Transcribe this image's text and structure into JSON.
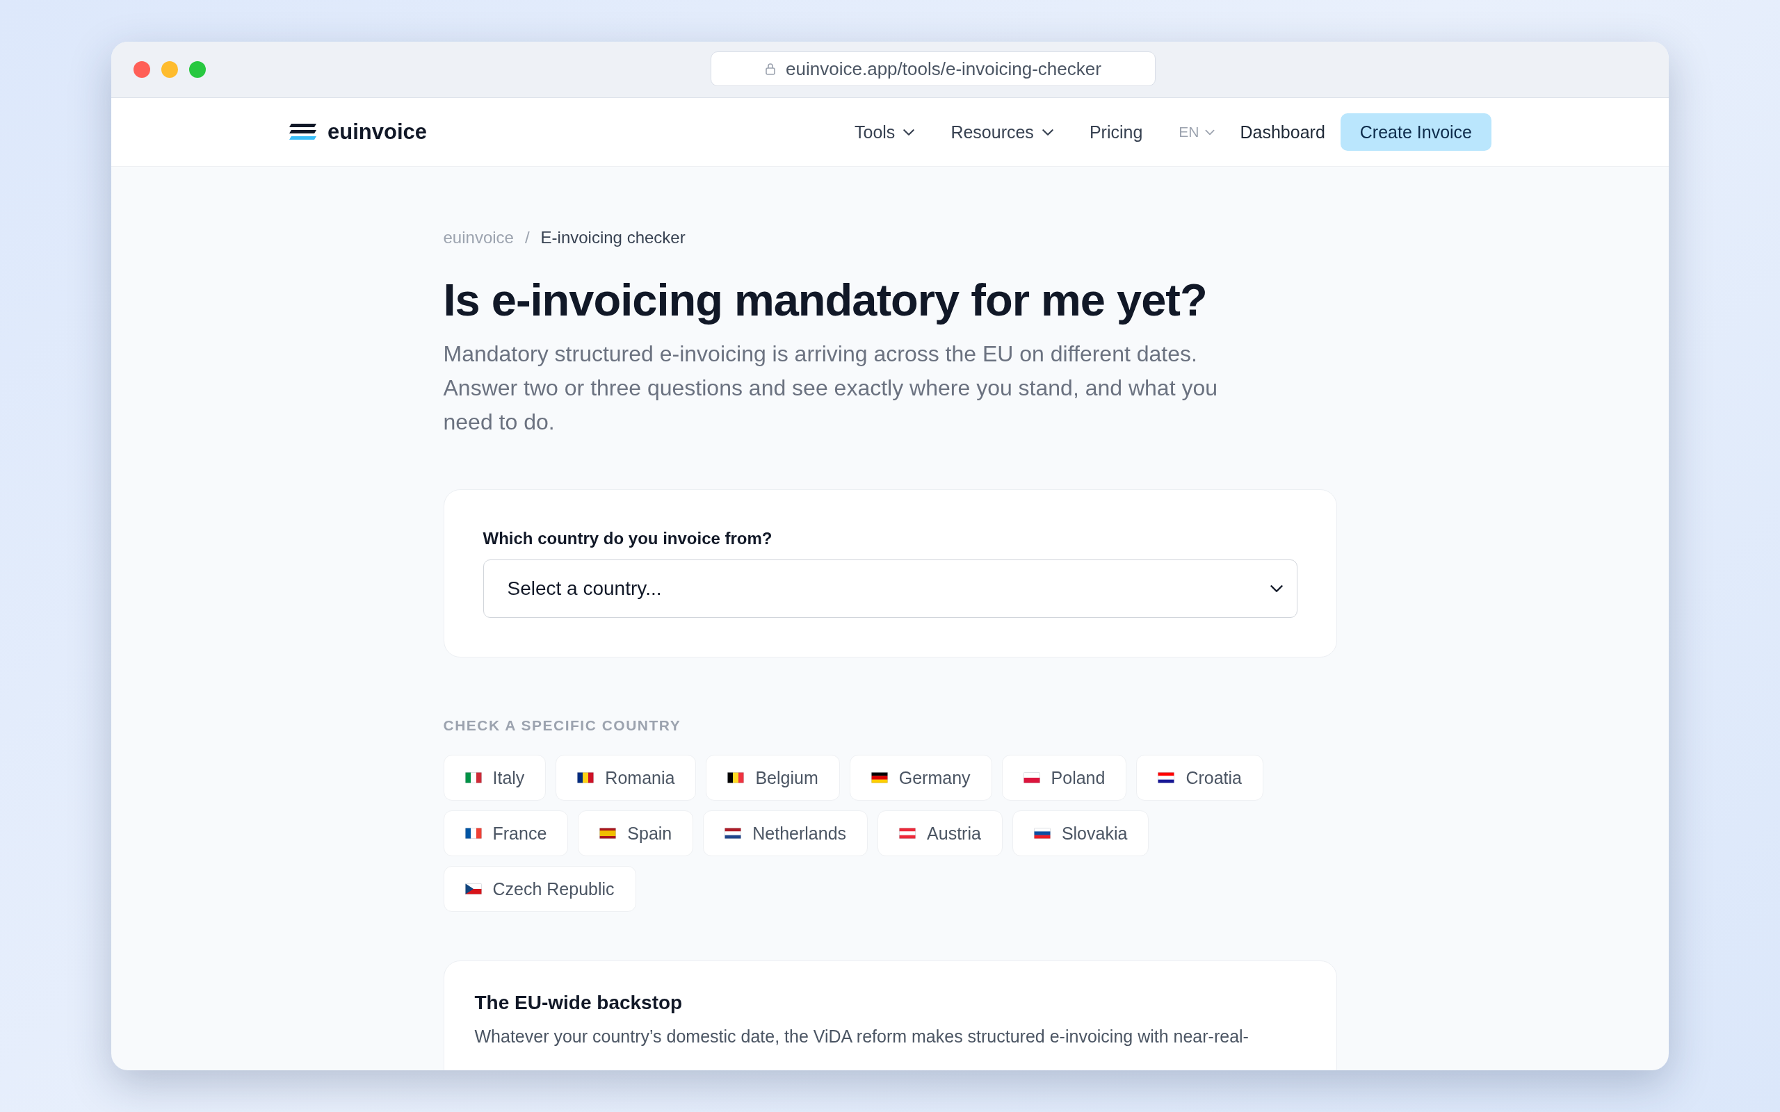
{
  "browser": {
    "url": "euinvoice.app/tools/e-invoicing-checker"
  },
  "nav": {
    "brand": "euinvoice",
    "items": [
      {
        "label": "Tools",
        "dropdown": true
      },
      {
        "label": "Resources",
        "dropdown": true
      },
      {
        "label": "Pricing",
        "dropdown": false
      }
    ],
    "language": "EN",
    "dashboard": "Dashboard",
    "cta": "Create Invoice"
  },
  "breadcrumb": {
    "items": [
      "euinvoice",
      "E-invoicing checker"
    ],
    "separator": "/"
  },
  "title": "Is e-invoicing mandatory for me yet?",
  "intro": "Mandatory structured e-invoicing is arriving across the EU on different dates. Answer two or three questions and see exactly where you stand, and what you need to do.",
  "question": {
    "label": "Which country do you invoice from?",
    "value": "Select a country..."
  },
  "countries_heading": "CHECK A SPECIFIC COUNTRY",
  "countries": [
    {
      "name": "Italy"
    },
    {
      "name": "Romania"
    },
    {
      "name": "Belgium"
    },
    {
      "name": "Germany"
    },
    {
      "name": "Poland"
    },
    {
      "name": "Croatia"
    },
    {
      "name": "France"
    },
    {
      "name": "Spain"
    },
    {
      "name": "Netherlands"
    },
    {
      "name": "Austria"
    },
    {
      "name": "Slovakia"
    },
    {
      "name": "Czech Republic"
    }
  ],
  "backstop": {
    "title": "The EU-wide backstop",
    "text": "Whatever your country’s domestic date, the ViDA reform makes structured e-invoicing with near-real-"
  }
}
